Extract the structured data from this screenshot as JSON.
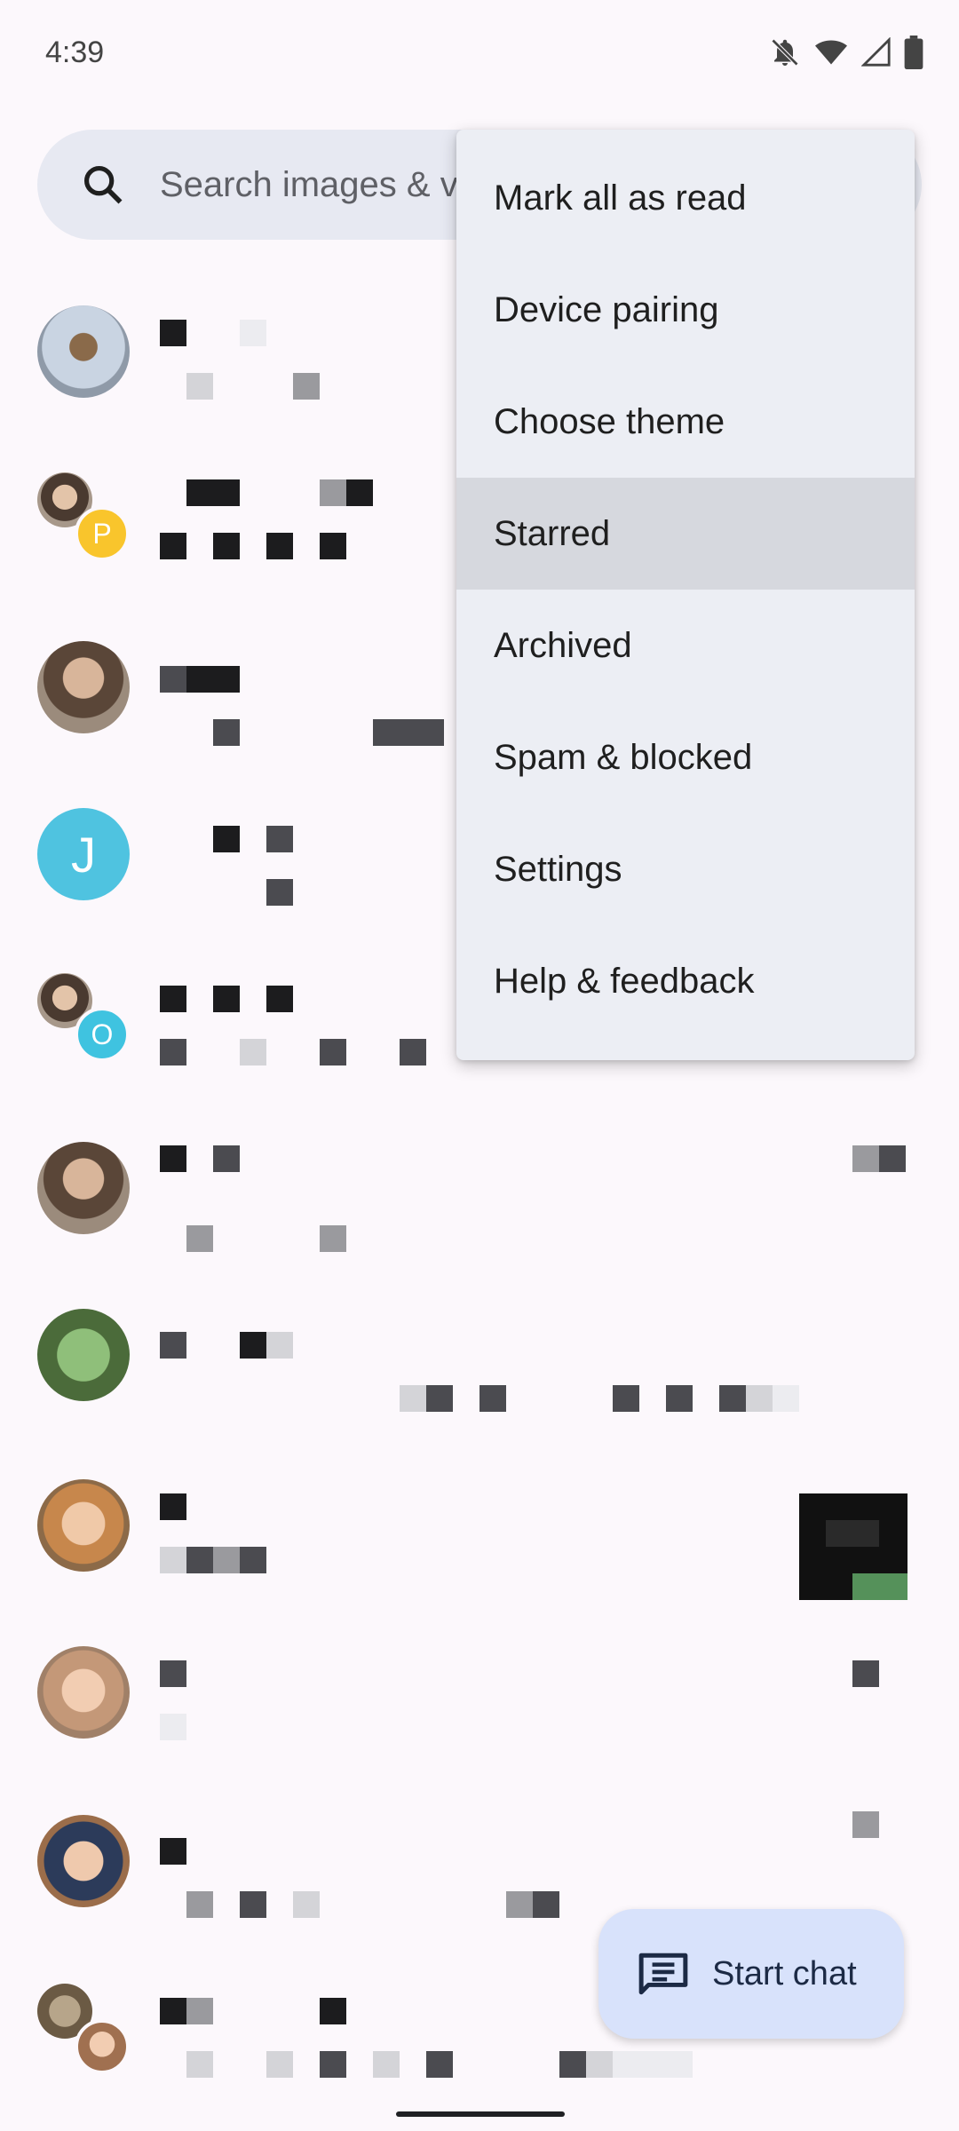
{
  "status_bar": {
    "time": "4:39",
    "icons": [
      "notifications-off-icon",
      "wifi-icon",
      "signal-icon",
      "battery-icon"
    ]
  },
  "search": {
    "placeholder": "Search images & v"
  },
  "conversations": [
    {
      "avatar": "photo",
      "avatar_name": "person-photo"
    },
    {
      "avatar": "group",
      "badge_letter": "P",
      "badge_color": "#f9c52c"
    },
    {
      "avatar": "photo",
      "avatar_name": "person-photo"
    },
    {
      "avatar": "letter",
      "letter": "J",
      "color": "#4fc3e0"
    },
    {
      "avatar": "group",
      "badge_letter": "O",
      "badge_color": "#3fc3e0"
    },
    {
      "avatar": "photo",
      "avatar_name": "person-photo"
    },
    {
      "avatar": "photo",
      "avatar_name": "frog-photo"
    },
    {
      "avatar": "photo",
      "avatar_name": "person-photo"
    },
    {
      "avatar": "photo",
      "avatar_name": "person-photo"
    },
    {
      "avatar": "photo",
      "avatar_name": "person-photo"
    },
    {
      "avatar": "group",
      "avatar_name": "group-photo"
    }
  ],
  "menu": {
    "items": [
      "Mark all as read",
      "Device pairing",
      "Choose theme",
      "Starred",
      "Archived",
      "Spam & blocked",
      "Settings",
      "Help & feedback"
    ],
    "highlighted_index": 3
  },
  "fab": {
    "label": "Start chat",
    "icon": "message-icon"
  },
  "colors": {
    "background": "#fcf8fc",
    "search_bg": "#e7e9f2",
    "menu_bg": "#eceef4",
    "fab_bg": "#d8e2fb"
  }
}
